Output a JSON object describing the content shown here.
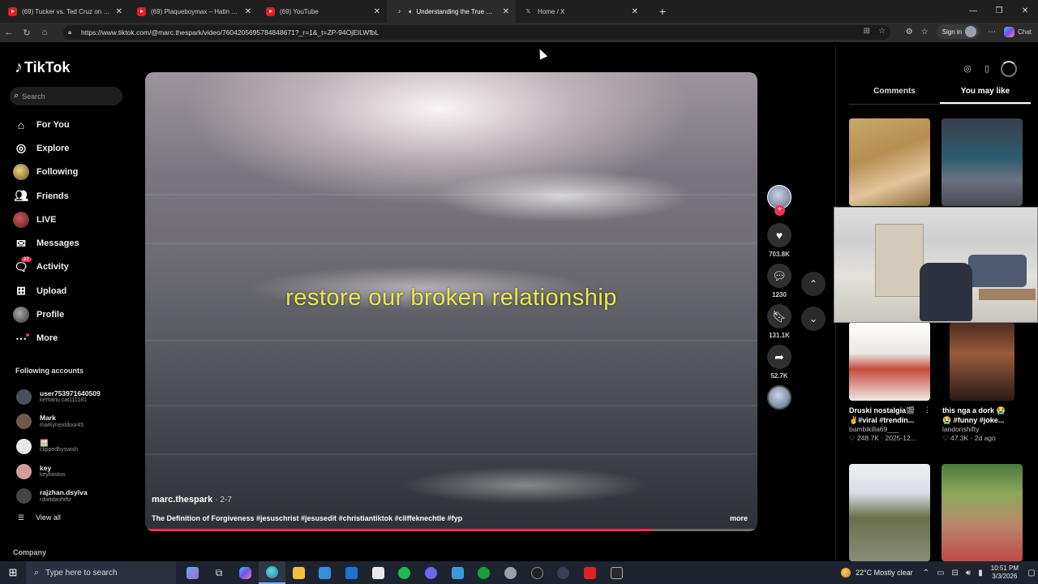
{
  "browser": {
    "tabs": [
      {
        "title": "(69) Tucker vs. Ted Cruz on War w",
        "type": "youtube",
        "active": false
      },
      {
        "title": "(69) Plaqueboymax – Hatin Ass N",
        "type": "youtube",
        "active": false
      },
      {
        "title": "(69) YouTube",
        "type": "youtube",
        "active": false
      },
      {
        "title": "Understanding the True Mean",
        "type": "tiktok",
        "active": true
      },
      {
        "title": "Home / X",
        "type": "x",
        "active": false
      }
    ],
    "url": "https://www.tiktok.com/@marc.thespark/video/7604205695784848671?_r=1&_t=ZP-94OjEILWfbL",
    "signin_label": "Sign in",
    "copilot_label": "Chat"
  },
  "sidebar": {
    "logo": "TikTok",
    "search_placeholder": "Search",
    "menu": [
      {
        "label": "For You",
        "icon": "home-icon"
      },
      {
        "label": "Explore",
        "icon": "compass-icon"
      },
      {
        "label": "Following",
        "icon": "following-avatar-icon"
      },
      {
        "label": "Friends",
        "icon": "friends-icon"
      },
      {
        "label": "LIVE",
        "icon": "live-icon"
      },
      {
        "label": "Messages",
        "icon": "messages-icon"
      },
      {
        "label": "Activity",
        "icon": "activity-icon",
        "badge": "27"
      },
      {
        "label": "Upload",
        "icon": "upload-icon"
      },
      {
        "label": "Profile",
        "icon": "profile-avatar-icon"
      },
      {
        "label": "More",
        "icon": "more-icon"
      }
    ],
    "following_title": "Following accounts",
    "following": [
      {
        "name": "user753971640509",
        "handle": "kemariu.cat111181"
      },
      {
        "name": "Mark",
        "handle": "markynextdoor45"
      },
      {
        "name": "🪟",
        "handle": "clippedbyswish"
      },
      {
        "name": "key",
        "handle": "keybastos"
      },
      {
        "name": "rajzhan.dsylva",
        "handle": "rdwitdashiftz"
      }
    ],
    "view_all": "View all",
    "company": "Company"
  },
  "video": {
    "overlay_text": "restore our broken relationship",
    "author": "marc.thespark",
    "date": "· 2-7",
    "description": "The Definition of Forgiveness #jesuschrist #jesusedit #christiantiktok #cliffeknechtle #fyp",
    "more": "more",
    "progress": 0.83
  },
  "actions": {
    "likes": "703.8K",
    "comments": "1230",
    "saves": "131.1K",
    "shares": "52.7K"
  },
  "right_panel": {
    "tabs": [
      "Comments",
      "You may like"
    ],
    "active_tab": "You may like",
    "recommendations": [
      {
        "title1": "Druski nostalgia🎬",
        "title2": "✌️#viral #trendin...",
        "user": "bambikilla69___",
        "stats": "♡ 248.7K · 2025-12..."
      },
      {
        "title1": "this nga a dork 😭",
        "title2": "😭 #funny #joke...",
        "user": "landonshifty",
        "stats": "♡ 47.3K · 2d ago"
      }
    ]
  },
  "taskbar": {
    "search_placeholder": "Type here to search",
    "weather": "22°C  Mostly clear",
    "time": "10:51 PM",
    "date": "3/3/2026"
  }
}
